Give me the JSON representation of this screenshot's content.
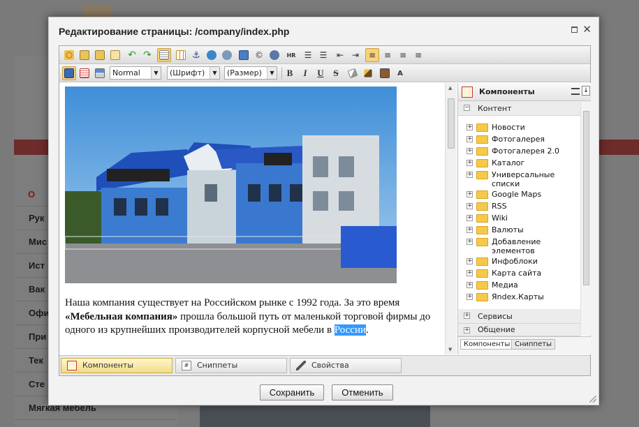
{
  "background_site": {
    "menu_items": [
      "О",
      "Рук",
      "Мис",
      "Ист",
      "Вак",
      "Офи",
      "При",
      "Тек",
      "Сте",
      "Мягкая мебель"
    ]
  },
  "dialog": {
    "title": "Редактирование страницы: /company/index.php",
    "buttons": {
      "save": "Сохранить",
      "cancel": "Отменить"
    }
  },
  "toolbar": {
    "format_select": "Normal",
    "font_select": "(Шрифт)",
    "size_select": "(Размер)",
    "bold": "B",
    "italic": "I",
    "underline": "U",
    "strike": "S"
  },
  "content": {
    "paragraph_start": "Наша компания существует на Российском рынке с 1992 года. За это время ",
    "paragraph_bold": "«Мебельная компания»",
    "paragraph_mid": " прошла большой путь от маленькой торговой фирмы до одного из крупнейших производителей корпусной мебели в ",
    "paragraph_highlight": "России",
    "paragraph_end": "."
  },
  "panel": {
    "title": "Компоненты",
    "section_content": "Контент",
    "tree": [
      "Новости",
      "Фотогалерея",
      "Фотогалерея 2.0",
      "Каталог",
      "Универсальные списки",
      "Google Maps",
      "RSS",
      "Wiki",
      "Валюты",
      "Добавление элементов",
      "Инфоблоки",
      "Карта сайта",
      "Медиа",
      "Яndex.Карты"
    ],
    "section_services": "Сервисы",
    "section_communication": "Общение",
    "tabs": [
      "Компоненты",
      "Сниппеты"
    ]
  },
  "bottom_tabs": [
    "Компоненты",
    "Сниппеты",
    "Свойства"
  ],
  "colors": {
    "accent": "#f7d27a",
    "highlight": "#3399ff",
    "folder": "#f6c94a"
  }
}
